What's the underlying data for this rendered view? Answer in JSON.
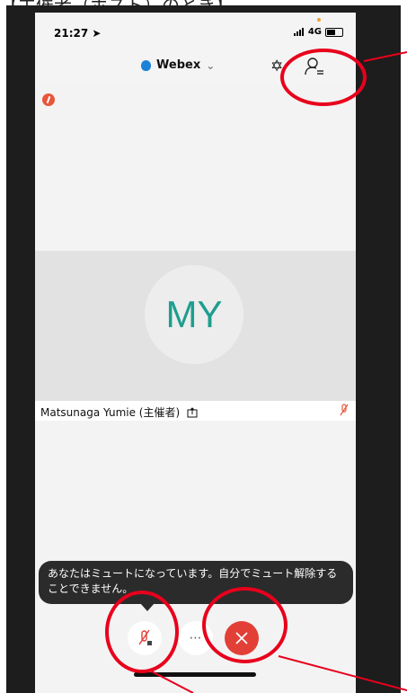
{
  "caption": "【主催者（ホスト）のとき】",
  "status_bar": {
    "time": "21:27 ➤",
    "network": "4G"
  },
  "header": {
    "app_name": "Webex",
    "dropdown_icon": "chevron-down-icon",
    "bluetooth_icon": "bluetooth-icon",
    "participants_icon": "participants-icon"
  },
  "avatar": {
    "initials": "MY"
  },
  "participant": {
    "name": "Matsunaga Yumie (主催者)"
  },
  "toast": {
    "message": "あなたはミュートになっています。自分でミュート解除することできません。"
  },
  "controls": {
    "more_label": "⋯"
  },
  "colors": {
    "annotation": "#e8001c",
    "end_button": "#e23f36",
    "avatar_text": "#1d9e8f",
    "webex_shield": "#1b82d8"
  }
}
